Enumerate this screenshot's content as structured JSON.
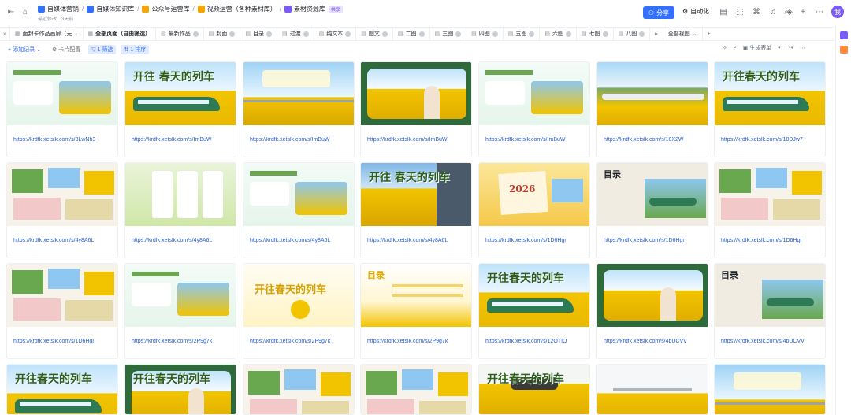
{
  "header": {
    "breadcrumbs": [
      {
        "label": "自媒体营销",
        "color": "#3370ff"
      },
      {
        "label": "自媒体知识库",
        "color": "#3370ff"
      },
      {
        "label": "公众号运营库",
        "color": "#f7a400"
      },
      {
        "label": "视频运营（各种素材库）",
        "color": "#f7a400"
      },
      {
        "label": "素材资源库",
        "color": "#7a5af8"
      }
    ],
    "badge": "共享",
    "subline": "最近修改：3天前",
    "share_label": "分享",
    "automation_label": "自动化",
    "avatar_initial": "我"
  },
  "tabs": [
    {
      "label": "面封卡作品画廊（元…",
      "active": false
    },
    {
      "label": "全部页面（自由筛选）",
      "active": true
    },
    {
      "label": "最新作品",
      "active": false
    },
    {
      "label": "封面",
      "active": false
    },
    {
      "label": "目录",
      "active": false
    },
    {
      "label": "过渡",
      "active": false
    },
    {
      "label": "纯文本",
      "active": false
    },
    {
      "label": "图文",
      "active": false
    },
    {
      "label": "二图",
      "active": false
    },
    {
      "label": "三图",
      "active": false
    },
    {
      "label": "四图",
      "active": false
    },
    {
      "label": "五图",
      "active": false
    },
    {
      "label": "六图",
      "active": false
    },
    {
      "label": "七图",
      "active": false
    },
    {
      "label": "八图",
      "active": false
    }
  ],
  "tabs_more_label": "全部视图",
  "toolbar": {
    "add_record": "添加记录",
    "card_config": "卡片配置",
    "filter": "1 筛选",
    "sort": "1 排序",
    "gen_form": "生成表单"
  },
  "cards": [
    {
      "link": "https://krdfk.xetslk.com/s/3LwNh3",
      "theme": "info-light",
      "title": ""
    },
    {
      "link": "https://krdfk.xetslk.com/s/ImBuW",
      "theme": "train-cover",
      "title": "开往 春天的列车"
    },
    {
      "link": "https://krdfk.xetslk.com/s/ImBuW",
      "theme": "rail-sky",
      "title": ""
    },
    {
      "link": "https://krdfk.xetslk.com/s/ImBuW",
      "theme": "window-green",
      "title": ""
    },
    {
      "link": "https://krdfk.xetslk.com/s/ImBuW",
      "theme": "info-light",
      "title": ""
    },
    {
      "link": "https://krdfk.xetslk.com/s/10X2W",
      "theme": "mountain-train",
      "title": ""
    },
    {
      "link": "https://krdfk.xetslk.com/s/18DJw7",
      "theme": "train-cover",
      "title": "开往春天的列车"
    },
    {
      "link": "https://krdfk.xetslk.com/s/4y8A6L",
      "theme": "collage",
      "title": ""
    },
    {
      "link": "https://krdfk.xetslk.com/s/4y8A6L",
      "theme": "panels",
      "title": ""
    },
    {
      "link": "https://krdfk.xetslk.com/s/4y8A6L",
      "theme": "info-light",
      "title": ""
    },
    {
      "link": "https://krdfk.xetslk.com/s/4y8A6L",
      "theme": "field-blue",
      "title": "开往 春天的列车"
    },
    {
      "link": "https://krdfk.xetslk.com/s/1D6Hgi",
      "theme": "poster-2026",
      "title": "2026"
    },
    {
      "link": "https://krdfk.xetslk.com/s/1D6Hgi",
      "theme": "catalog-train",
      "title": "目录"
    },
    {
      "link": "https://krdfk.xetslk.com/s/1D6Hgi",
      "theme": "collage",
      "title": ""
    },
    {
      "link": "https://krdfk.xetslk.com/s/1D6Hgi",
      "theme": "collage",
      "title": ""
    },
    {
      "link": "https://krdfk.xetslk.com/s/2P9g7k",
      "theme": "info-light",
      "title": ""
    },
    {
      "link": "https://krdfk.xetslk.com/s/2P9g7k",
      "theme": "title-flowers",
      "title": "开往春天的列车"
    },
    {
      "link": "https://krdfk.xetslk.com/s/2P9g7k",
      "theme": "catalog-light",
      "title": "目录"
    },
    {
      "link": "https://krdfk.xetslk.com/s/12OTIO",
      "theme": "train-cover",
      "title": "开往春天的列车"
    },
    {
      "link": "https://krdfk.xetslk.com/s/4bUCVV",
      "theme": "window-green",
      "title": ""
    },
    {
      "link": "https://krdfk.xetslk.com/s/4bUCVV",
      "theme": "catalog-train",
      "title": "目录"
    },
    {
      "link": "",
      "theme": "train-cover",
      "title": "开往春天的列车"
    },
    {
      "link": "",
      "theme": "window-green",
      "title": "开往春天的列车"
    },
    {
      "link": "",
      "theme": "collage",
      "title": ""
    },
    {
      "link": "",
      "theme": "collage",
      "title": ""
    },
    {
      "link": "",
      "theme": "field-steam",
      "title": "开往春天的列车"
    },
    {
      "link": "",
      "theme": "snow-field",
      "title": ""
    },
    {
      "link": "",
      "theme": "rail-sky",
      "title": ""
    }
  ],
  "colors": {
    "accent": "#3370ff",
    "link": "#245bdb",
    "rapeseed": "#f2c400",
    "sky": "#8ec7f0",
    "grass": "#6aa84f"
  }
}
